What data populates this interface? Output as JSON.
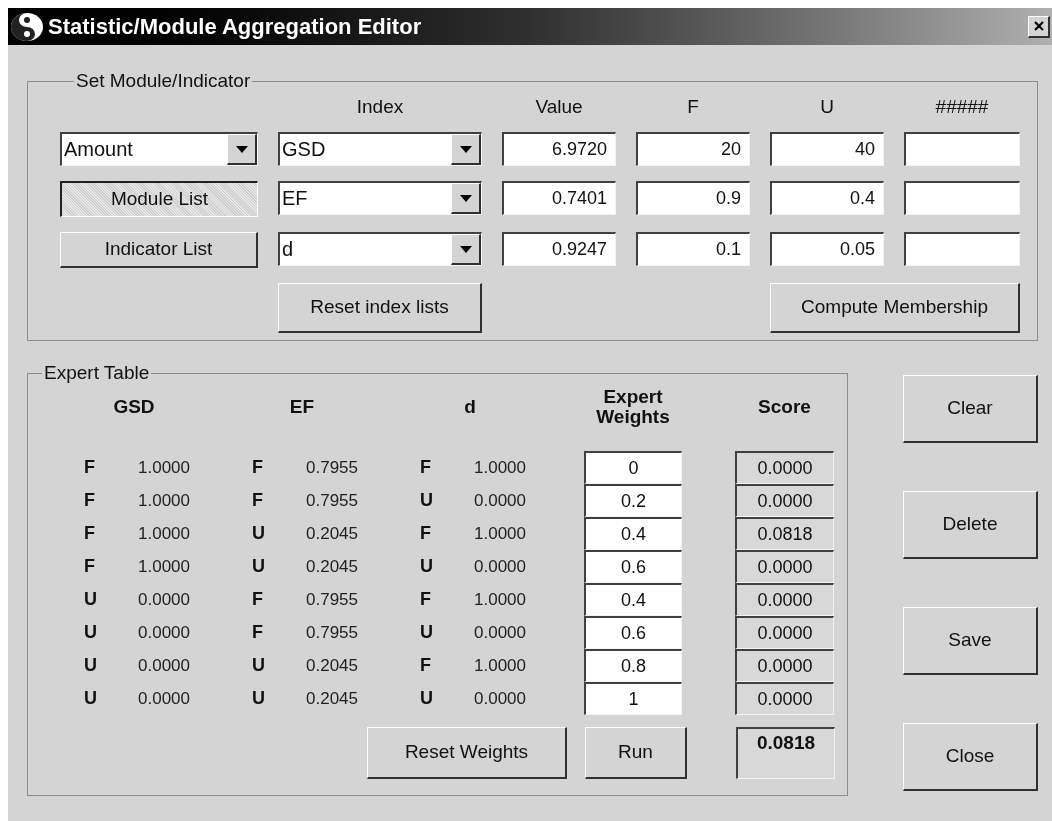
{
  "window": {
    "title": "Statistic/Module Aggregation Editor"
  },
  "module_group": {
    "title": "Set Module/Indicator",
    "columns": [
      "Index",
      "Value",
      "F",
      "U",
      "#####"
    ],
    "type_select": {
      "value": "Amount"
    },
    "list_buttons": [
      {
        "label": "Module List",
        "pressed": true
      },
      {
        "label": "Indicator List",
        "pressed": false
      }
    ],
    "rows": [
      {
        "index": "GSD",
        "value": "6.9720",
        "f": "20",
        "u": "40"
      },
      {
        "index": "EF",
        "value": "0.7401",
        "f": "0.9",
        "u": "0.4"
      },
      {
        "index": "d",
        "value": "0.9247",
        "f": "0.1",
        "u": "0.05"
      }
    ],
    "reset_button": "Reset index lists",
    "compute_button": "Compute Membership"
  },
  "expert_table": {
    "title": "Expert Table",
    "columns": [
      "GSD",
      "EF",
      "d"
    ],
    "weights_header": "Expert Weights",
    "score_header": "Score",
    "rows": [
      {
        "cells": [
          {
            "set": "F",
            "value": "1.0000"
          },
          {
            "set": "F",
            "value": "0.7955"
          },
          {
            "set": "F",
            "value": "1.0000"
          }
        ],
        "weight": "0",
        "score": "0.0000"
      },
      {
        "cells": [
          {
            "set": "F",
            "value": "1.0000"
          },
          {
            "set": "F",
            "value": "0.7955"
          },
          {
            "set": "U",
            "value": "0.0000"
          }
        ],
        "weight": "0.2",
        "score": "0.0000"
      },
      {
        "cells": [
          {
            "set": "F",
            "value": "1.0000"
          },
          {
            "set": "U",
            "value": "0.2045"
          },
          {
            "set": "F",
            "value": "1.0000"
          }
        ],
        "weight": "0.4",
        "score": "0.0818"
      },
      {
        "cells": [
          {
            "set": "F",
            "value": "1.0000"
          },
          {
            "set": "U",
            "value": "0.2045"
          },
          {
            "set": "U",
            "value": "0.0000"
          }
        ],
        "weight": "0.6",
        "score": "0.0000"
      },
      {
        "cells": [
          {
            "set": "U",
            "value": "0.0000"
          },
          {
            "set": "F",
            "value": "0.7955"
          },
          {
            "set": "F",
            "value": "1.0000"
          }
        ],
        "weight": "0.4",
        "score": "0.0000"
      },
      {
        "cells": [
          {
            "set": "U",
            "value": "0.0000"
          },
          {
            "set": "F",
            "value": "0.7955"
          },
          {
            "set": "U",
            "value": "0.0000"
          }
        ],
        "weight": "0.6",
        "score": "0.0000"
      },
      {
        "cells": [
          {
            "set": "U",
            "value": "0.0000"
          },
          {
            "set": "U",
            "value": "0.2045"
          },
          {
            "set": "F",
            "value": "1.0000"
          }
        ],
        "weight": "0.8",
        "score": "0.0000"
      },
      {
        "cells": [
          {
            "set": "U",
            "value": "0.0000"
          },
          {
            "set": "U",
            "value": "0.2045"
          },
          {
            "set": "U",
            "value": "0.0000"
          }
        ],
        "weight": "1",
        "score": "0.0000"
      }
    ],
    "reset_weights_button": "Reset Weights",
    "run_button": "Run",
    "total_score": "0.0818"
  },
  "side_buttons": [
    "Clear",
    "Delete",
    "Save",
    "Close"
  ]
}
